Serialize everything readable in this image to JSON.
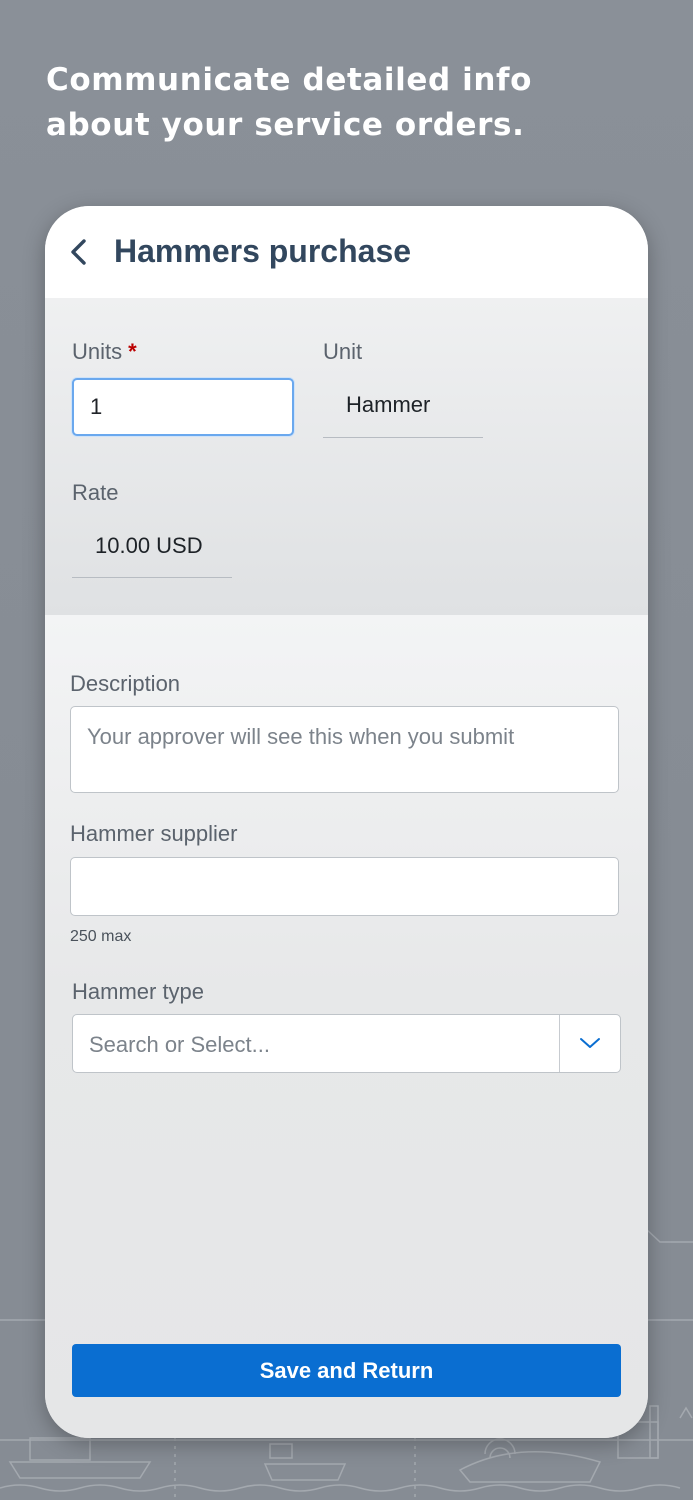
{
  "headline": {
    "line1": "Communicate detailed info",
    "line2": "about your service orders."
  },
  "nav": {
    "back_icon": "chevron-left-icon",
    "title": "Hammers purchase"
  },
  "header": {
    "units_label": "Units",
    "units_required_marker": "*",
    "units_value": "1",
    "unit_label": "Unit",
    "unit_value": "Hammer",
    "rate_label": "Rate",
    "rate_value": "10.00 USD"
  },
  "form": {
    "description_label": "Description",
    "description_placeholder": "Your approver will see this when you submit",
    "supplier_label": "Hammer supplier",
    "supplier_value": "",
    "supplier_helper": "250 max",
    "type_label": "Hammer type",
    "type_placeholder": "Search or Select...",
    "type_dropdown_icon": "chevron-down-icon"
  },
  "footer": {
    "save_label": "Save and Return"
  },
  "colors": {
    "background": "#878d95",
    "brand_blue": "#0a6ed1",
    "title_text": "#32475e",
    "focus_border": "#6aa8ee",
    "required": "#bb0000"
  }
}
